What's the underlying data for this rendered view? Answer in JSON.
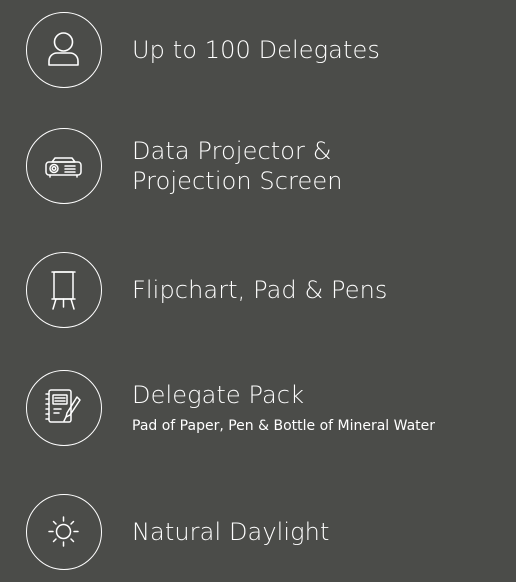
{
  "features": [
    {
      "icon": "person-icon",
      "title": "Up to 100 Delegates"
    },
    {
      "icon": "projector-icon",
      "title_line1": "Data Projector &",
      "title_line2": "Projection Screen"
    },
    {
      "icon": "easel-icon",
      "title": "Flipchart, Pad & Pens"
    },
    {
      "icon": "notepad-pen-icon",
      "title": "Delegate Pack",
      "subtitle": "Pad of Paper, Pen & Bottle of Mineral Water"
    },
    {
      "icon": "sun-icon",
      "title": "Natural Daylight"
    }
  ],
  "colors": {
    "background": "#4b4c49",
    "foreground": "#ffffff"
  }
}
